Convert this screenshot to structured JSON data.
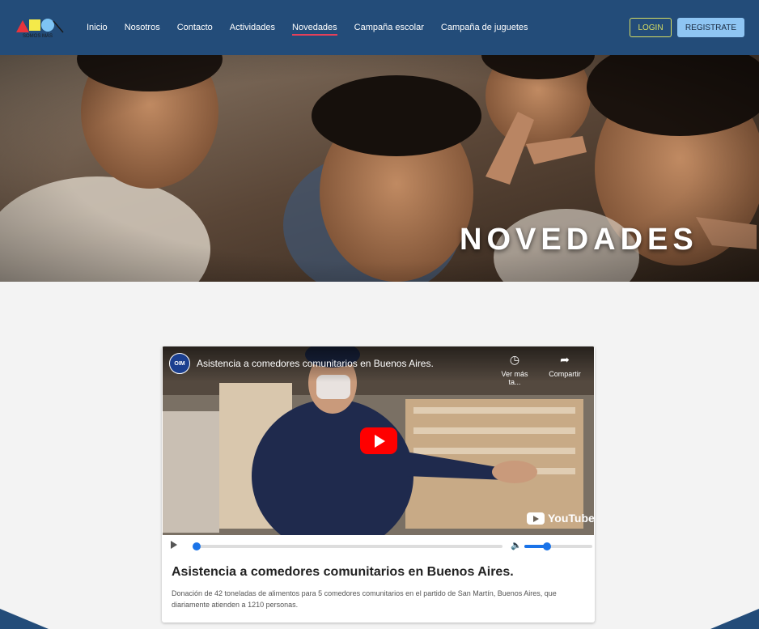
{
  "brand": {
    "logo_text": "SOMOS MÁS"
  },
  "nav": {
    "items": [
      {
        "label": "Inicio"
      },
      {
        "label": "Nosotros"
      },
      {
        "label": "Contacto"
      },
      {
        "label": "Actividades"
      },
      {
        "label": "Novedades",
        "active": true
      },
      {
        "label": "Campaña escolar"
      },
      {
        "label": "Campaña de juguetes"
      }
    ],
    "login_label": "LOGIN",
    "register_label": "REGISTRATE"
  },
  "hero": {
    "title": "NOVEDADES"
  },
  "news": {
    "video": {
      "channel_badge": "OIM",
      "title": "Asistencia a comedores comunitarios en Buenos Aires.",
      "watch_later_label": "Ver más ta...",
      "share_label": "Compartir",
      "platform_label": "YouTube",
      "progress": 0.0,
      "volume": 0.33
    },
    "title": "Asistencia a comedores comunitarios en Buenos Aires.",
    "description": "Donación de 42 toneladas de alimentos para 5 comedores comunitarios en el partido de San Martín, Buenos Aires, que diariamente atienden a 1210 personas."
  },
  "colors": {
    "navbar": "#234c79",
    "active_underline": "#e5405a",
    "login_border": "#d7de63",
    "register_bg": "#8ec5f3",
    "page_bg": "#f3f3f3",
    "player_accent": "#1a73e8",
    "youtube_red": "#ff0000"
  }
}
